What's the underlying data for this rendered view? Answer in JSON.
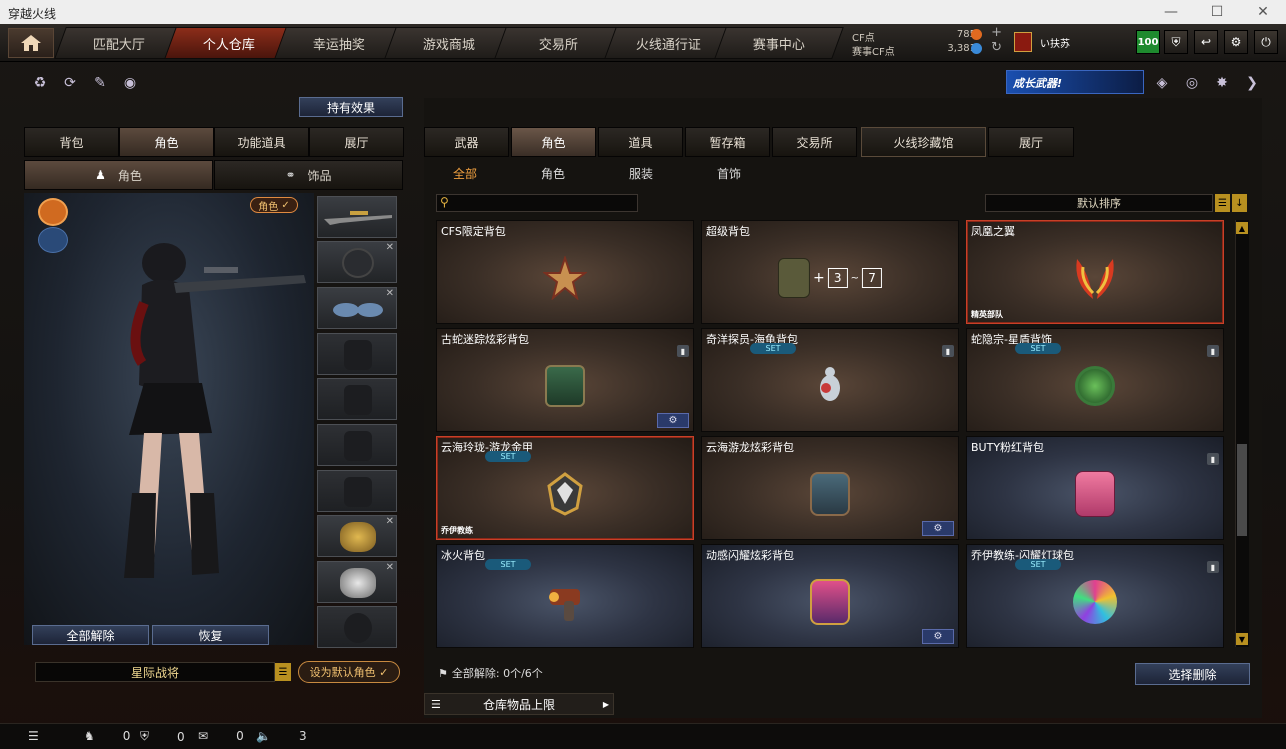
{
  "window": {
    "title": "穿越火线"
  },
  "topnav": {
    "tabs": [
      {
        "label": "匹配大厅"
      },
      {
        "label": "个人仓库",
        "active": true
      },
      {
        "label": "幸运抽奖"
      },
      {
        "label": "游戏商城"
      },
      {
        "label": "交易所"
      },
      {
        "label": "火线通行证"
      },
      {
        "label": "赛事中心"
      }
    ]
  },
  "currency": {
    "cf_label": "CF点",
    "cf_value": "785",
    "event_label": "赛事CF点",
    "event_value": "3,381"
  },
  "player": {
    "name": "い扶苏",
    "level": "100"
  },
  "banner": {
    "text": "成长武器!"
  },
  "left": {
    "effects_button": "持有效果",
    "tabs": [
      {
        "label": "背包"
      },
      {
        "label": "角色",
        "active": true
      },
      {
        "label": "功能道具"
      },
      {
        "label": "展厅"
      }
    ],
    "subtabs": [
      {
        "label": "角色",
        "active": true
      },
      {
        "label": "饰品"
      }
    ],
    "role_badge": "角色",
    "remove_all": "全部解除",
    "restore": "恢复",
    "character_name": "星际战将",
    "set_default": "设为默认角色"
  },
  "right": {
    "categories": [
      {
        "label": "武器"
      },
      {
        "label": "角色",
        "active": true
      },
      {
        "label": "道具"
      },
      {
        "label": "暂存箱"
      },
      {
        "label": "交易所"
      },
      {
        "label": "火线珍藏馆"
      },
      {
        "label": "展厅"
      }
    ],
    "filters": [
      {
        "label": "全部",
        "active": true
      },
      {
        "label": "角色"
      },
      {
        "label": "服装"
      },
      {
        "label": "首饰"
      }
    ],
    "search": {
      "placeholder": ""
    },
    "sort": {
      "label": "默认排序"
    },
    "items": [
      {
        "name": "CFS限定背包",
        "theme": "warm"
      },
      {
        "name": "超级背包",
        "theme": "warm",
        "badge1": "3",
        "badge2": "7"
      },
      {
        "name": "凤凰之翼",
        "theme": "warm",
        "selected": true,
        "tag": "精英部队"
      },
      {
        "name": "古蛇迷踪炫彩背包",
        "theme": "warm",
        "lock": true,
        "gear": true
      },
      {
        "name": "奇洋探员-海龟背包",
        "theme": "warm",
        "set": "SET",
        "lock": true
      },
      {
        "name": "蛇隐宗-星盾背饰",
        "theme": "warm",
        "set": "SET",
        "lock": true
      },
      {
        "name": "云海玲珑-游龙金甲",
        "theme": "warm",
        "set": "SET",
        "selected": true,
        "tag": "乔伊教练"
      },
      {
        "name": "云海游龙炫彩背包",
        "theme": "warm",
        "gear": true
      },
      {
        "name": "BUTY粉红背包",
        "theme": "cool",
        "lock": true
      },
      {
        "name": "冰火背包",
        "theme": "cool",
        "set": "SET"
      },
      {
        "name": "动感闪耀炫彩背包",
        "theme": "cool",
        "gear": true
      },
      {
        "name": "乔伊教练-闪耀灯球包",
        "theme": "cool",
        "set": "SET",
        "lock": true
      }
    ],
    "remove_info": "全部解除: 0个/6个",
    "select_delete": "选择删除",
    "storage_limit": "仓库物品上限"
  },
  "statusbar": {
    "c1": "0",
    "c2": "0",
    "c3": "0",
    "c4": "3"
  }
}
